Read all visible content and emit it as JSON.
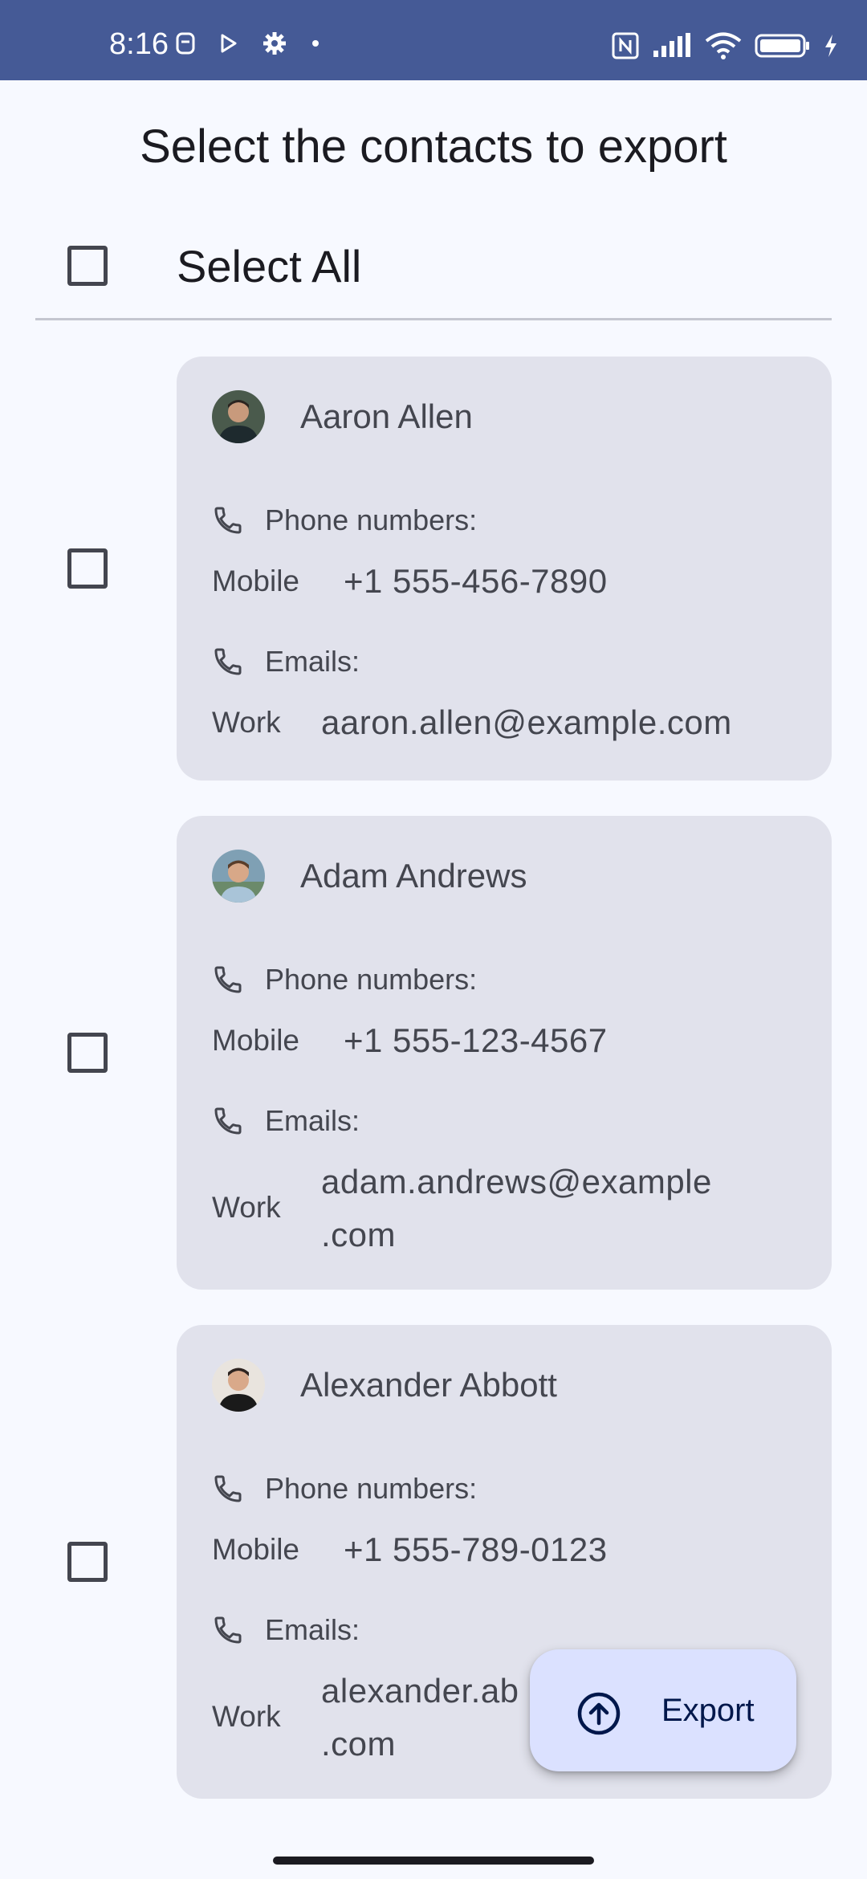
{
  "status_bar": {
    "time": "8:16",
    "left_icons": [
      "lens-icon",
      "play-icon",
      "gear-icon",
      "dot-icon"
    ],
    "right_icons": [
      "nfc-icon",
      "signal-icon",
      "wifi-icon",
      "battery-icon",
      "charging-icon"
    ]
  },
  "header": {
    "title": "Select the contacts to export"
  },
  "select_all": {
    "label": "Select All",
    "checked": false
  },
  "contacts": [
    {
      "name": "Aaron Allen",
      "checked": false,
      "phone_section_label": "Phone numbers:",
      "phones": [
        {
          "type": "Mobile",
          "value": "+1 555-456-7890"
        }
      ],
      "email_section_label": "Emails:",
      "emails": [
        {
          "type": "Work",
          "value": "aaron.allen@example.com"
        }
      ]
    },
    {
      "name": "Adam Andrews",
      "checked": false,
      "phone_section_label": "Phone numbers:",
      "phones": [
        {
          "type": "Mobile",
          "value": "+1 555-123-4567"
        }
      ],
      "email_section_label": "Emails:",
      "emails": [
        {
          "type": "Work",
          "value_line1": "adam.andrews@example",
          "value_line2": ".com"
        }
      ]
    },
    {
      "name": "Alexander Abbott",
      "checked": false,
      "phone_section_label": "Phone numbers:",
      "phones": [
        {
          "type": "Mobile",
          "value": "+1 555-789-0123"
        }
      ],
      "email_section_label": "Emails:",
      "emails": [
        {
          "type": "Work",
          "value_line1": "alexander.ab",
          "value_line2": ".com"
        }
      ]
    }
  ],
  "fab": {
    "label": "Export",
    "icon": "upload-circle-icon"
  },
  "colors": {
    "status_bar": "#455a96",
    "background": "#f7f9ff",
    "card": "#e1e2ec",
    "fab": "#dbe1ff",
    "fab_text": "#00174b"
  }
}
